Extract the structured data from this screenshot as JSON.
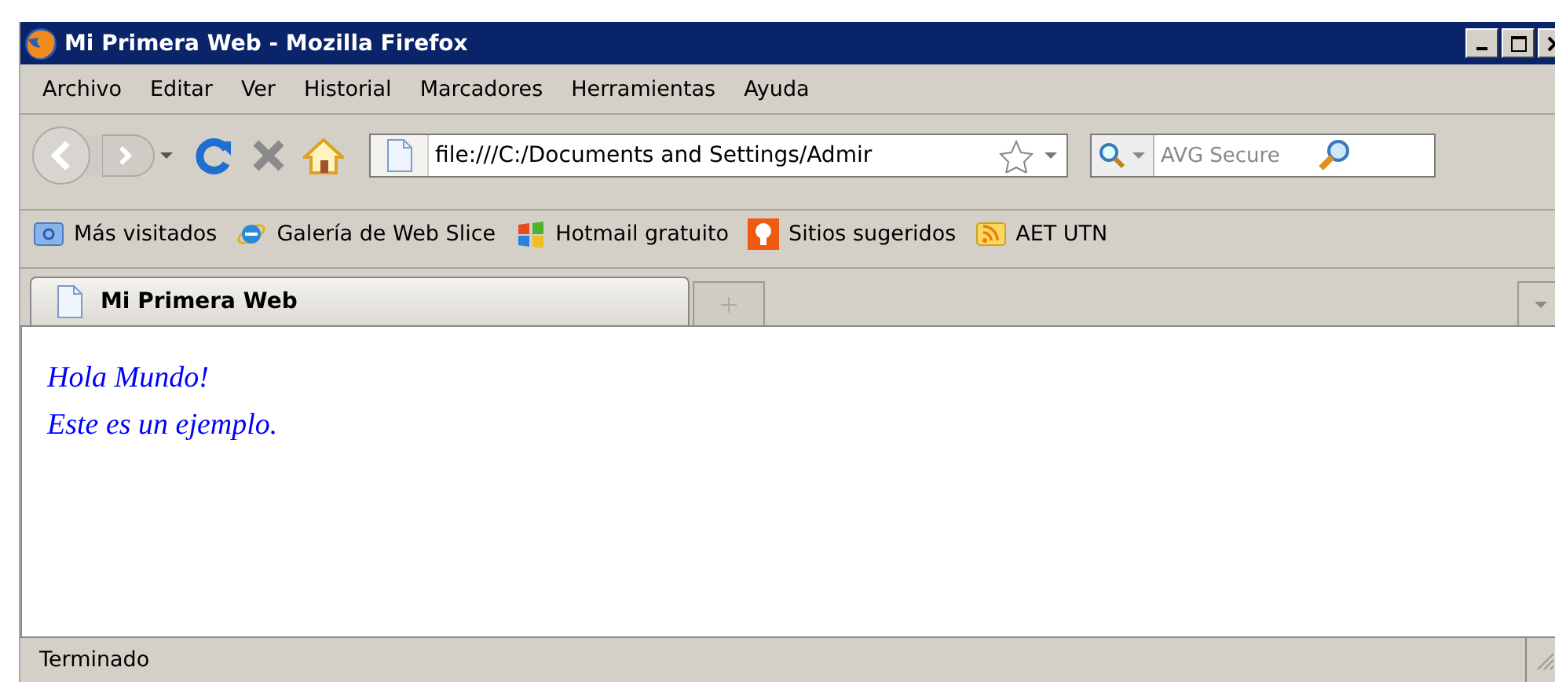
{
  "window": {
    "title": "Mi Primera Web - Mozilla Firefox"
  },
  "menu": [
    "Archivo",
    "Editar",
    "Ver",
    "Historial",
    "Marcadores",
    "Herramientas",
    "Ayuda"
  ],
  "toolbar": {
    "url": "file:///C:/Documents and Settings/Admir",
    "search_placeholder": "AVG Secure"
  },
  "bookmarks": [
    {
      "label": "Más visitados",
      "kind": "folder"
    },
    {
      "label": "Galería de Web Slice",
      "kind": "ie"
    },
    {
      "label": "Hotmail gratuito",
      "kind": "windows"
    },
    {
      "label": "Sitios sugeridos",
      "kind": "bulb"
    },
    {
      "label": "AET UTN",
      "kind": "rss"
    }
  ],
  "tabs": [
    {
      "label": "Mi Primera Web",
      "selected": true
    }
  ],
  "content": {
    "lines": [
      "Hola Mundo!",
      "Este es un ejemplo."
    ]
  },
  "status_bar": "Terminado"
}
